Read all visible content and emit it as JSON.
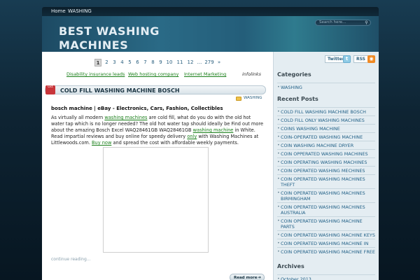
{
  "nav": {
    "home": "Home",
    "washing": "WASHING"
  },
  "header": {
    "title": "BEST WASHING MACHINES",
    "search_placeholder": "Search here..."
  },
  "pagination": {
    "pages": [
      "1",
      "2",
      "3",
      "4",
      "5",
      "6",
      "7",
      "8",
      "9",
      "10",
      "11",
      "12",
      "...",
      "279",
      "»"
    ],
    "current": "1"
  },
  "ads": {
    "links": [
      "Disability insurance leads",
      "Web hosting company",
      "Internet Marketing"
    ],
    "brand": "infolinks"
  },
  "post": {
    "date_badge": "Oct",
    "title": "COLD FILL WASHING MACHINE BOSCH",
    "category": "WASHING",
    "subheading": "bosch machine | eBay - Electronics, Cars, Fashion, Collectibles",
    "body": {
      "t1": "As virtually all modern ",
      "l1": "washing machines",
      "t2": " are cold fill, what do you do with the old hot water tap which is no longer needed? The old hot water tap should ideally be Find out more about the amazing Bosch Excel WAQ28461GB WAQ28461GB ",
      "l2": "washing machine",
      "t3": " in White. Read impartial reviews and buy online for speedy delivery ",
      "l3": "only",
      "t4": " with Washing Machines at Littlewoods.com. ",
      "l4": "Buy now",
      "t5": " and spread the cost with affordable weekly payments."
    },
    "continue": "continue reading...",
    "read_more": "Read more"
  },
  "social": {
    "twitter": "Twitter",
    "twitter_glyph": "t",
    "rss": "RSS"
  },
  "sidebar": {
    "categories_title": "Categories",
    "categories": [
      "WASHING"
    ],
    "recent_title": "Recent Posts",
    "recent": [
      "COLD FILL WASHING MACHINE BOSCH",
      "COLD FILL ONLY WASHING MACHINES",
      "COINS WASHING MACHINE",
      "COIN-OPERATED WASHING MACHINE",
      "COIN WASHING MACHINE DRYER",
      "COIN OPPERATED WASHING MACHINES",
      "COIN OPERATING WASHING MACHINES",
      "COIN OPERATED WASHING MECHINES",
      "COIN OPERATED WASHING MACHINES THEFT",
      "COIN OPERATED WASHING MACHINES BIRMINGHAM",
      "COIN OPERATED WASHING MACHINES AUSTRALIA",
      "COIN OPERATED WASHING MACHINE PARTS",
      "COIN OPERATED WASHING MACHINE KEYS",
      "COIN OPERATED WASHING MACHINE IN",
      "COIN OPERATED WASHING MACHINE FREE"
    ],
    "archives_title": "Archives",
    "archives": [
      "October 2013"
    ]
  }
}
